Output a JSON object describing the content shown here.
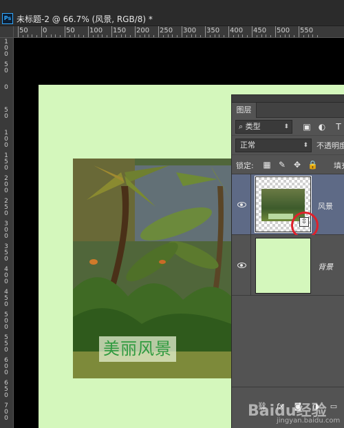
{
  "window": {
    "app_logo": "Ps",
    "document_title": "未标题-2 @ 66.7% (风景, RGB/8) *"
  },
  "ruler_top": [
    "50",
    "0",
    "50",
    "100",
    "150",
    "200",
    "250",
    "300",
    "350",
    "400",
    "450",
    "500",
    "550"
  ],
  "ruler_left": [
    "1 0 0",
    "5 0",
    "0",
    "5 0",
    "1 0 0",
    "1 5 0",
    "2 0 0",
    "2 5 0",
    "3 0 0",
    "3 5 0",
    "4 0 0",
    "4 5 0",
    "5 0 0",
    "5 5 0",
    "6 0 0",
    "6 5 0",
    "7 0 0"
  ],
  "canvas": {
    "background_color": "#d4f7bc",
    "photo_caption": "美丽风景"
  },
  "layers_panel": {
    "tab_label": "图层",
    "filter_label": "类型",
    "blend_mode": "正常",
    "opacity_label": "不透明度",
    "lock_label": "锁定:",
    "fill_label": "填充",
    "layers": [
      {
        "name": "风景",
        "selected": true,
        "smart_object": true
      },
      {
        "name": "背景",
        "selected": false,
        "smart_object": false
      }
    ]
  },
  "watermark": {
    "logo": "Baidu经验",
    "url": "jingyan.baidu.com"
  },
  "colors": {
    "selection_highlight": "#5e6a86",
    "annotation_circle": "#e0202a",
    "caption_green": "#2f9a3f"
  }
}
